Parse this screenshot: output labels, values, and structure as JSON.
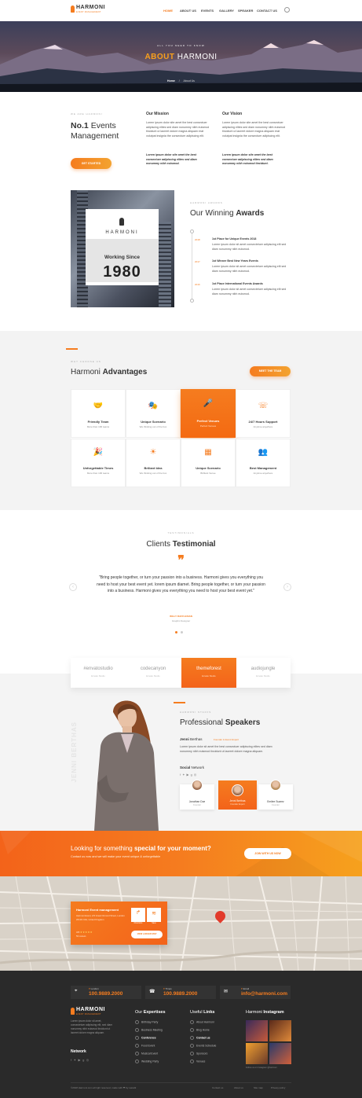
{
  "header": {
    "brand": "HARMONI",
    "tagline": "EVENT MANAGEMENT",
    "nav": [
      "HOME",
      "ABOUT US",
      "EVENTS",
      "GALLERY",
      "SPEAKER",
      "CONTACT US"
    ]
  },
  "hero": {
    "kicker": "ALL YOU NEED TO KNOW",
    "title_accent": "ABOUT",
    "title_rest": "HARMONI",
    "crumb_home": "Home",
    "crumb_sep": "/",
    "crumb_page": "About Us"
  },
  "intro": {
    "kicker": "WE ARE HARMONI",
    "no1": "No.1",
    "title_rest": "Events",
    "title_line2": "Management",
    "cta": "GET STARTED",
    "mission_title": "Our Mission",
    "mission_body": "Lorem ipsum dolor site amet the best consectuer adipiscing elites sed diam nonummy nibh euismod tincidunt ut laoreet dolore magna aliquam erat volutpat insignia the consectuer adipiscing elit.",
    "mission_em": "Lorem ipsum dolor site amet the best consectuer adipiscing elites sed diam nonummy nibh euismod.",
    "vision_title": "Our Vision",
    "vision_body": "Lorem ipsum dolor site amet the best consectuer adipiscing elites sed diam nonummy nibh euismod tincidunt ut laoreet dolore magna aliquam erat volutpat insignia the consectuer adipiscing elit.",
    "vision_em": "Lorem ipsum dolor site amet the best consectuer adipiscing elites sed diam nonummy nibh euismod tincidunt."
  },
  "since": {
    "brand": "HARMONI",
    "label": "Working Since",
    "year": "1980"
  },
  "awards": {
    "kicker": "HARMONI AWARDS",
    "title_rest": "Our Winning",
    "title_bold": "Awards",
    "items": [
      {
        "year": "2018",
        "title": "1st Place for Unique Events 2018",
        "body": "Lorem ipsum dolor sit amet consectetuer adipiscing elit sed diam nonummy nibh euismod."
      },
      {
        "year": "2017",
        "title": "1st Winner Best New Years Events",
        "body": "Lorem ipsum dolor sit amet consectetuer adipiscing elit sed diam nonummy nibh euismod."
      },
      {
        "year": "2016",
        "title": "1st Place International Events Awards",
        "body": "Lorem ipsum dolor sit amet consectetuer adipiscing elit sed diam nonummy nibh euismod."
      }
    ]
  },
  "advantages": {
    "kicker": "WHY CHOOSE US",
    "title_rest": "Harmoni",
    "title_bold": "Advantages",
    "cta": "MEET THE TEAM",
    "cards": [
      {
        "icon": "handshake-icon",
        "glyph": "🤝",
        "title": "Friendly Team",
        "sub": "More than 100 teams"
      },
      {
        "icon": "scenario-icon",
        "glyph": "🎭",
        "title": "Unique Scenario",
        "sub": "We thinking out of the box"
      },
      {
        "icon": "microphone-icon",
        "glyph": "🎤",
        "title": "Perfect Venues",
        "sub": "Perfect Venues"
      },
      {
        "icon": "support-icon",
        "glyph": "☏",
        "title": "24/7 Hours Support",
        "sub": "Anytime anywhere"
      },
      {
        "icon": "party-hat-icon",
        "glyph": "🎉",
        "title": "Unforgettable Times",
        "sub": "More than 100 teams"
      },
      {
        "icon": "idea-icon",
        "glyph": "☀",
        "title": "Briliant Idea",
        "sub": "We thinking out of the box"
      },
      {
        "icon": "calendar-icon",
        "glyph": "▦",
        "title": "Unique Scenario",
        "sub": "Brilliant Venue"
      },
      {
        "icon": "people-icon",
        "glyph": "👥",
        "title": "Best Management",
        "sub": "Anytime anywhere"
      }
    ]
  },
  "testimonial": {
    "kicker": "TESTIMONIALS",
    "title_rest": "Clients",
    "title_bold": "Testimonial",
    "quote": "\"Bring people together, or turn your passion into a business. Harmoni gives you everything you need to host your best event yet. lorem ipsum diamet. Bring people together, or turn your passion into a business. Harmoni gives you everything you need to host your best event yet.\"",
    "author": "WILLY RAFFLESIAN",
    "role": "Graphic Designer"
  },
  "sponsors": [
    {
      "name": "#envatostudio",
      "sub": "Envato Studio"
    },
    {
      "name": "codecanyon",
      "sub": "Envato Studio"
    },
    {
      "name": "themeforest",
      "sub": "Envato Studio"
    },
    {
      "name": "audiojungle",
      "sub": "Envato Studio"
    }
  ],
  "speakers": {
    "kicker": "HARMONI STAFFS",
    "title_rest": "Professional",
    "title_bold": "Speakers",
    "vertical": "JENNI BERTHAS",
    "name_first": "Jenni",
    "name_last": "Berthas",
    "role": "Founder & Event Expert",
    "body": "Lorem ipsum dolor sit amet the best consectuer adipiscing elites sed diam nonummy nibh euismod tincidunt ut laoreet dolore magna aliquam.",
    "social_label": "Social",
    "social_rest": "Network",
    "people": [
      {
        "name": "Jonathan Doe",
        "role": "Founder"
      },
      {
        "name": "Jenni Berthas",
        "role": "Founder Expert"
      },
      {
        "name": "Emilee Suarez",
        "role": "Founder"
      }
    ]
  },
  "cta": {
    "lead": "Looking for something",
    "bold": "special for your moment?",
    "sub": "Contact us now and we will make your event unique & unforgettable",
    "button": "JOIN WITH US NOW"
  },
  "map": {
    "card_title": "Harmoni Event management",
    "card_lines": "Harmoni Event, 2/3 Great Ormond Street, London WC1N 3JH, United Kingdom",
    "rating": "4.5",
    "reviews": "56 reviews",
    "btn1": "Directions",
    "btn2": "Save",
    "cta": "VIEW LARGER MAP"
  },
  "footer": {
    "contacts": [
      {
        "label": "London",
        "value": "100.9889.2000"
      },
      {
        "label": "Times",
        "value": "100.9889.2000"
      },
      {
        "label": "Email",
        "value": "info@harmoni.com"
      }
    ],
    "brand": "HARMONI",
    "tagline": "EVENT MANAGEMENT",
    "about": "Lorem ipsum dolor sit amet, consectetuer adipiscing elit, sed diam nonummy nibh euismod tincidunt ut laoreet dolore magna aliquam.",
    "network": "Network",
    "expertise_title_a": "Our",
    "expertise_title_b": "Expertises",
    "expertise": [
      "Birthday Party",
      "Business Meeting",
      "Conference",
      "Food Event",
      "Musical Event",
      "Wedding Party"
    ],
    "links_title_a": "Useful",
    "links_title_b": "Links",
    "links": [
      "About Harmoni",
      "Blog Home",
      "Contact us",
      "Events Schedule",
      "Sponsors",
      "Venues"
    ],
    "insta_title_a": "Harmoni",
    "insta_title_b": "Instagram",
    "insta_note": "Follow us on Instagram @harmoni",
    "copyright": "©2018 Harmoni.com all right reserved, made with ❤ by Laradit",
    "bottom_links": [
      "Contact us",
      "About us",
      "Site map",
      "Privacy policy"
    ]
  }
}
